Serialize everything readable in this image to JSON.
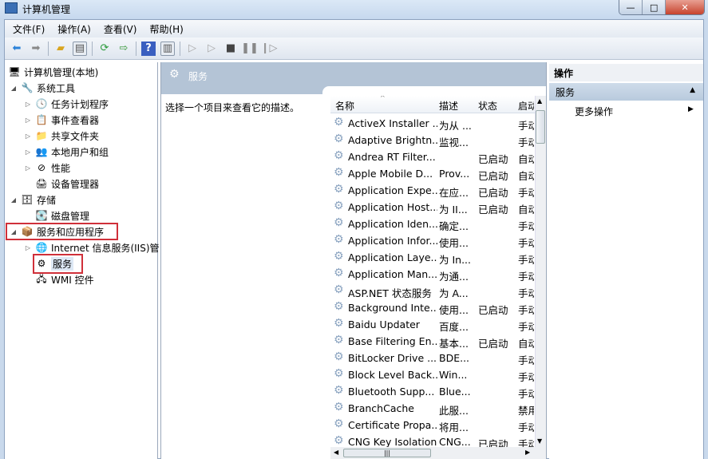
{
  "window": {
    "title": "计算机管理",
    "minimize": "—",
    "maximize": "□",
    "close": "✕"
  },
  "menu": [
    "文件(F)",
    "操作(A)",
    "查看(V)",
    "帮助(H)"
  ],
  "toolbar_icons": [
    "back-arrow",
    "forward-arrow",
    "up-folder",
    "show-hide-console-tree",
    "refresh",
    "export-list",
    "help",
    "show-hide-action-pane",
    "start-service",
    "start-service-alt",
    "stop-service",
    "pause-service",
    "resume-service"
  ],
  "tree": [
    {
      "label": "计算机管理(本地)",
      "level": 0,
      "expander": ""
    },
    {
      "label": "系统工具",
      "level": 1,
      "expander": "◢"
    },
    {
      "label": "任务计划程序",
      "level": 2,
      "expander": "▷"
    },
    {
      "label": "事件查看器",
      "level": 2,
      "expander": "▷"
    },
    {
      "label": "共享文件夹",
      "level": 2,
      "expander": "▷"
    },
    {
      "label": "本地用户和组",
      "level": 2,
      "expander": "▷"
    },
    {
      "label": "性能",
      "level": 2,
      "expander": "▷"
    },
    {
      "label": "设备管理器",
      "level": 2,
      "expander": ""
    },
    {
      "label": "存储",
      "level": 1,
      "expander": "◢"
    },
    {
      "label": "磁盘管理",
      "level": 2,
      "expander": ""
    },
    {
      "label": "服务和应用程序",
      "level": 1,
      "expander": "◢",
      "highlighted": true
    },
    {
      "label": "Internet 信息服务(IIS)管",
      "level": 2,
      "expander": "▷"
    },
    {
      "label": "服务",
      "level": 2,
      "expander": "",
      "highlighted": true,
      "selected": true
    },
    {
      "label": "WMI 控件",
      "level": 2,
      "expander": ""
    }
  ],
  "main": {
    "title": "服务",
    "description": "选择一个项目来查看它的描述。",
    "columns": [
      "名称",
      "描述",
      "状态",
      "启动"
    ],
    "rows": [
      [
        "ActiveX Installer ...",
        "为从 ...",
        "",
        "手动"
      ],
      [
        "Adaptive Brightn...",
        "监视...",
        "",
        "手动"
      ],
      [
        "Andrea RT Filter...",
        "",
        "已启动",
        "自动"
      ],
      [
        "Apple Mobile D...",
        "Prov...",
        "已启动",
        "自动"
      ],
      [
        "Application Expe...",
        "在应...",
        "已启动",
        "手动"
      ],
      [
        "Application Host...",
        "为 II...",
        "已启动",
        "自动"
      ],
      [
        "Application Iden...",
        "确定...",
        "",
        "手动"
      ],
      [
        "Application Infor...",
        "使用...",
        "",
        "手动"
      ],
      [
        "Application Laye...",
        "为 In...",
        "",
        "手动"
      ],
      [
        "Application Man...",
        "为通...",
        "",
        "手动"
      ],
      [
        "ASP.NET 状态服务",
        "为 A...",
        "",
        "手动"
      ],
      [
        "Background Inte...",
        "使用...",
        "已启动",
        "手动"
      ],
      [
        "Baidu Updater",
        "百度...",
        "",
        "手动"
      ],
      [
        "Base Filtering En...",
        "基本...",
        "已启动",
        "自动"
      ],
      [
        "BitLocker Drive ...",
        "BDE...",
        "",
        "手动"
      ],
      [
        "Block Level Back...",
        "Win...",
        "",
        "手动"
      ],
      [
        "Bluetooth Supp...",
        "Blue...",
        "",
        "手动"
      ],
      [
        "BranchCache",
        "此服...",
        "",
        "禁用"
      ],
      [
        "Certificate Propa...",
        "将用...",
        "",
        "手动"
      ],
      [
        "CNG Key Isolation",
        "CNG...",
        "已启动",
        "手动"
      ]
    ]
  },
  "actions": {
    "header": "操作",
    "section": "服务",
    "more": "更多操作"
  },
  "colors": {
    "highlight": "#d0303a",
    "panel_header": "#b4c4d6"
  }
}
